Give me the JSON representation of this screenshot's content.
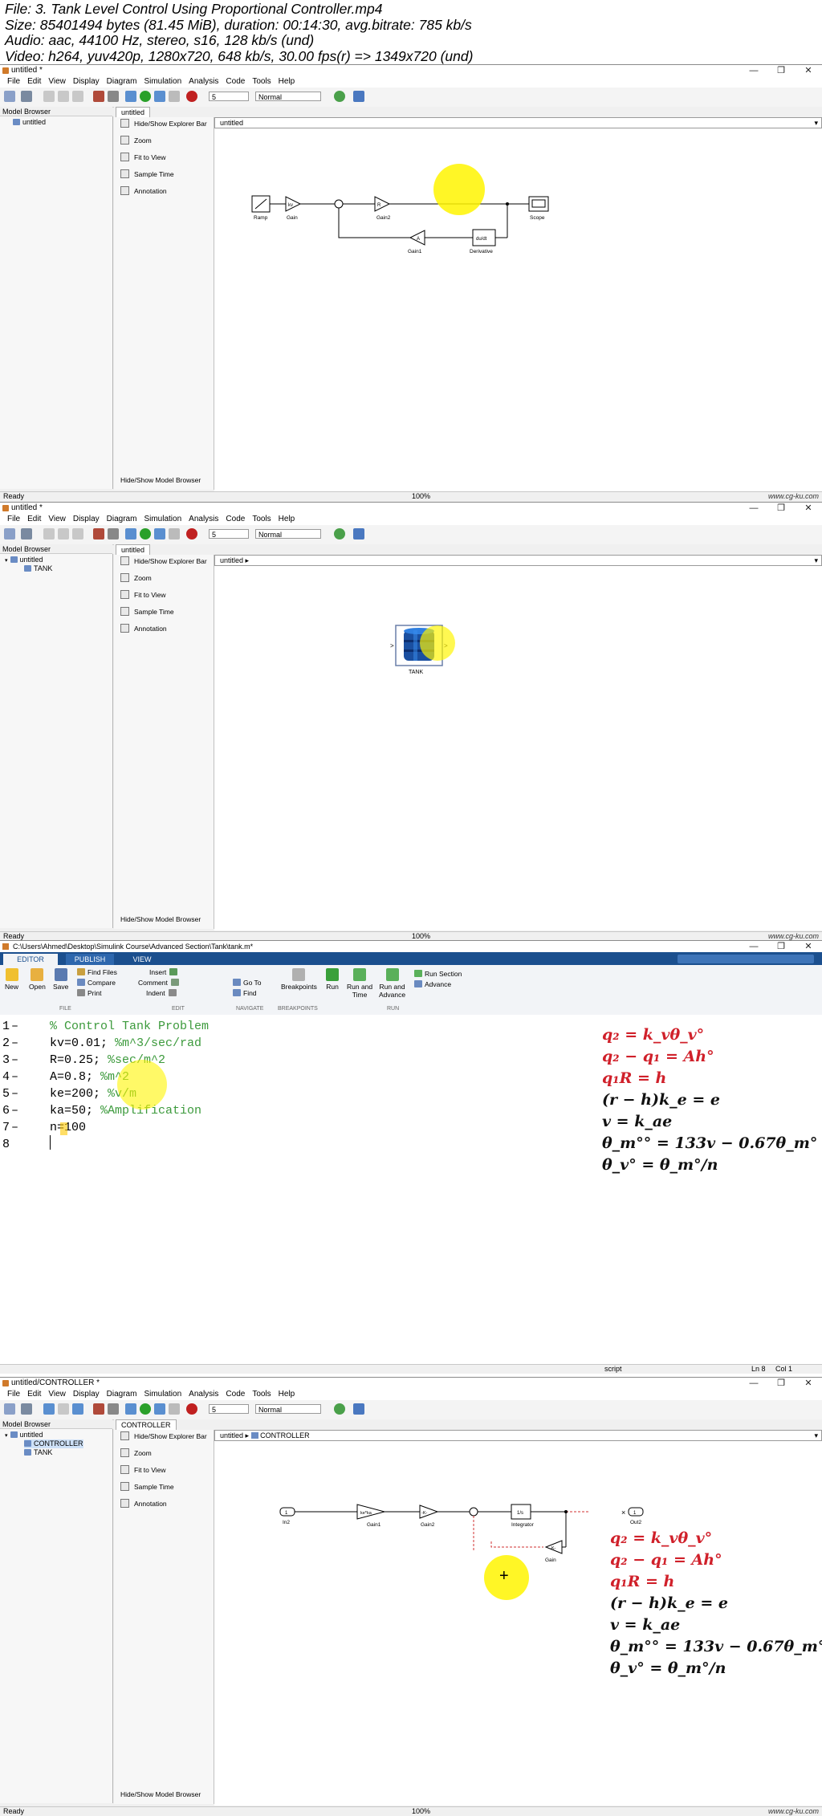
{
  "file_info": {
    "line1": "File: 3. Tank Level Control Using Proportional Controller.mp4",
    "line2": "Size: 85401494 bytes (81.45 MiB), duration: 00:14:30, avg.bitrate: 785 kb/s",
    "line3": "Audio: aac, 44100 Hz, stereo, s16, 128 kb/s (und)",
    "line4": "Video: h264, yuv420p, 1280x720, 648 kb/s, 30.00 fps(r) => 1349x720 (und)"
  },
  "menu": [
    "File",
    "Edit",
    "View",
    "Display",
    "Diagram",
    "Simulation",
    "Analysis",
    "Code",
    "Tools",
    "Help"
  ],
  "toolbar": {
    "stop_time": "5",
    "sim_mode": "Normal"
  },
  "palette": [
    "Hide/Show Explorer Bar",
    "Zoom",
    "Fit to View",
    "Sample Time",
    "Annotation"
  ],
  "palette_bottom": "Hide/Show Model Browser",
  "model_browser": "Model Browser",
  "status": {
    "ready": "Ready",
    "zoom": "100%",
    "watermark": "www.cg-ku.com"
  },
  "win_controls": {
    "min": "—",
    "max": "❐",
    "close": "✕"
  },
  "win1": {
    "title": "untitled *",
    "tab": "untitled",
    "tree": [
      "untitled"
    ],
    "explorer": "untitled",
    "blocks": {
      "ramp": "Ramp",
      "gain": "Gain",
      "gain2": "Gain2",
      "scope": "Scope",
      "gain1": "Gain1",
      "derivative": "Derivative",
      "gain_sym": "kv",
      "gain2_sym": "R",
      "gain1_sym": "A",
      "deriv_sym": "du/dt"
    }
  },
  "win2": {
    "title": "untitled *",
    "tab": "untitled",
    "tree": [
      "untitled",
      "TANK"
    ],
    "explorer": "untitled ▸",
    "blocks": {
      "tank": "TANK"
    }
  },
  "win3": {
    "title": "C:\\Users\\Ahmed\\Desktop\\Simulink Course\\Advanced Section\\Tank\\tank.m*",
    "tabs": [
      "EDITOR",
      "PUBLISH",
      "VIEW"
    ],
    "ribbon": {
      "new": "New",
      "open": "Open",
      "save": "Save",
      "find_files": "Find Files",
      "compare": "Compare",
      "print": "Print",
      "insert": "Insert",
      "comment": "Comment",
      "indent": "Indent",
      "go_to": "Go To",
      "find": "Find",
      "breakpoints": "Breakpoints",
      "run": "Run",
      "run_time": "Run and\nTime",
      "run_advance": "Run and\nAdvance",
      "run_section": "Run Section",
      "advance": "Advance",
      "groups": [
        "FILE",
        "EDIT",
        "NAVIGATE",
        "BREAKPOINTS",
        "RUN"
      ]
    },
    "code": [
      {
        "n": "1",
        "code": "",
        "comment": "% Control Tank Problem"
      },
      {
        "n": "2",
        "code": "kv=0.01; ",
        "comment": "%m^3/sec/rad"
      },
      {
        "n": "3",
        "code": "R=0.25; ",
        "comment": "%sec/m^2"
      },
      {
        "n": "4",
        "code": "A=0.8; ",
        "comment": "%m^2"
      },
      {
        "n": "5",
        "code": "ke=200; ",
        "comment": "%v/m"
      },
      {
        "n": "6",
        "code": "ka=50; ",
        "comment": "%Amplification"
      },
      {
        "n": "7",
        "code": "n=100",
        "comment": ""
      },
      {
        "n": "8",
        "code": "",
        "comment": ""
      }
    ],
    "status": {
      "script": "script",
      "ln": "Ln  8",
      "col": "Col  1"
    }
  },
  "win4": {
    "title": "untitled/CONTROLLER *",
    "tab": "CONTROLLER",
    "tree": [
      "untitled",
      "CONTROLLER",
      "TANK"
    ],
    "explorer": [
      "untitled",
      "CONTROLLER"
    ],
    "blocks": {
      "in": "In2",
      "gain1": "Gain1",
      "gain2": "Gain2",
      "integrator": "Integrator",
      "out": "Out2",
      "gain": "Gain",
      "in_num": "1",
      "out_num": "1",
      "gain1_sym": "ke*ka",
      "gain2_sym": "-K-",
      "int_sym": "1/s",
      "gain_sym": "-K-"
    }
  },
  "equations": [
    {
      "text": "q₂ = k_vθ_v°",
      "color": "red"
    },
    {
      "text": "q₂ − q₁ = Ah°",
      "color": "red"
    },
    {
      "text": "q₁R = h",
      "color": "red"
    },
    {
      "text": "(r − h)k_e = e",
      "color": "black"
    },
    {
      "text": "v = k_ae",
      "color": "black"
    },
    {
      "text": "θ_m°° = 133v − 0.67θ_m°",
      "color": "black"
    },
    {
      "text": "θ_v° = θ_m°/n",
      "color": "black"
    }
  ],
  "colors": {
    "ribbon_blue": "#1b4f8e",
    "highlight": "#fff500",
    "equation_red": "#d0202a",
    "comment_green": "#3c9a3c"
  }
}
